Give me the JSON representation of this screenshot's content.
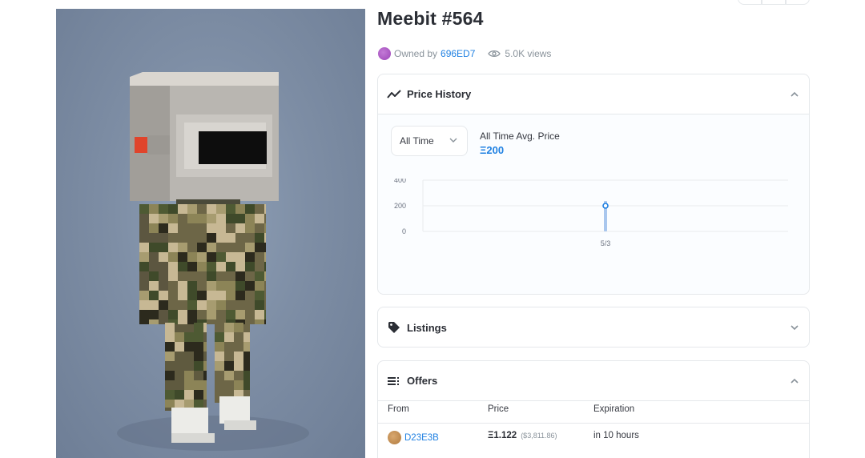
{
  "nft": {
    "title": "Meebit #564",
    "owned_by_prefix": "Owned by",
    "owner": "696ED7",
    "views": "5.0K views"
  },
  "price_history": {
    "header": "Price History",
    "filter_selected": "All Time",
    "avg_label": "All Time Avg. Price",
    "avg_value": "Ξ200"
  },
  "chart_data": {
    "type": "line",
    "x": [
      "5/3"
    ],
    "series": [
      {
        "values": [
          200
        ]
      }
    ],
    "yticks": [
      "400",
      "200",
      "0"
    ],
    "ylim": [
      0,
      400
    ],
    "grid": true
  },
  "listings": {
    "header": "Listings"
  },
  "offers": {
    "header": "Offers",
    "columns": {
      "from": "From",
      "price": "Price",
      "expiration": "Expiration"
    },
    "rows": [
      {
        "from": "D23E3B",
        "price": "Ξ1.122",
        "usd": "($3,811.86)",
        "expiration": "in 10 hours"
      }
    ]
  },
  "colors": {
    "accent": "#2081e2",
    "text": "#353840",
    "muted": "#8a939b",
    "border": "#e5e8eb"
  },
  "icons": [
    "eye-icon",
    "trend-line-icon",
    "tag-icon",
    "list-icon",
    "chevron-up-icon",
    "chevron-down-icon"
  ]
}
